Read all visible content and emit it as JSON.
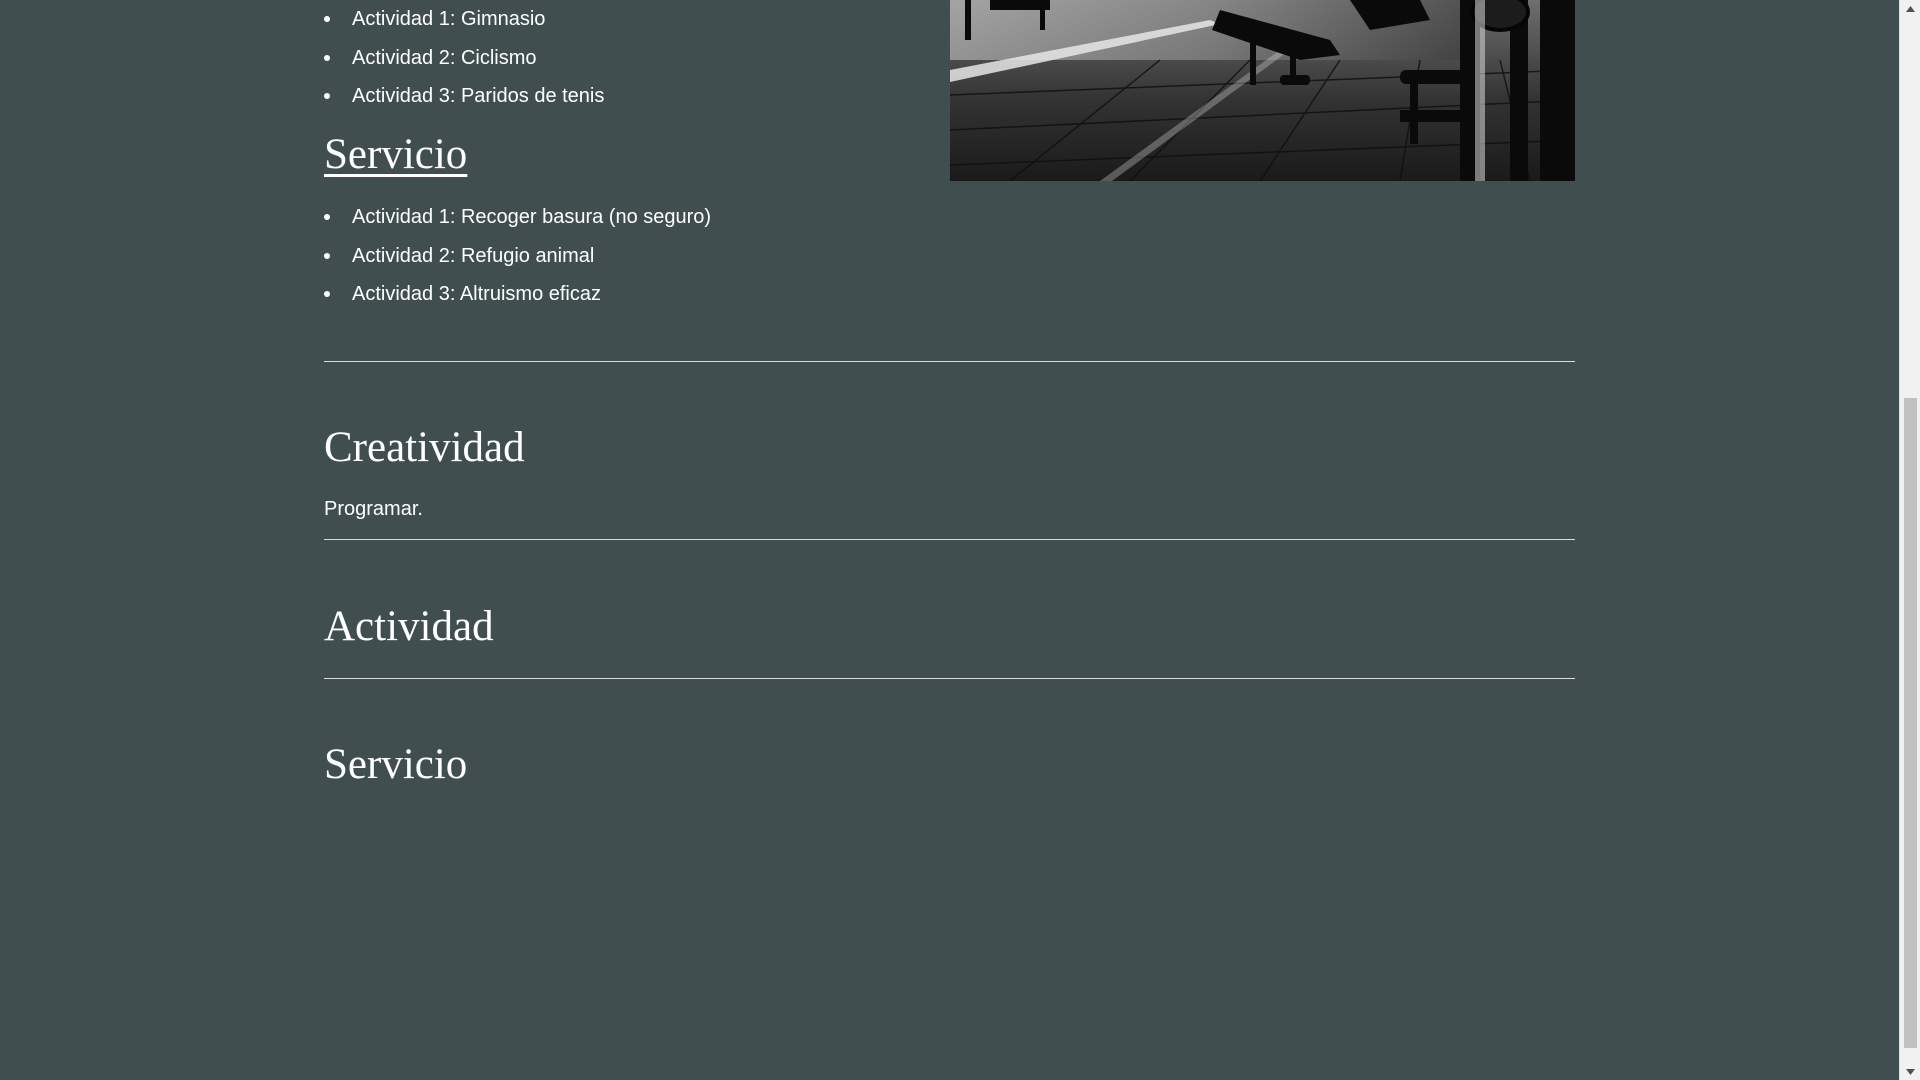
{
  "sections": {
    "top_list": [
      "Actividad 1: Gimnasio",
      "Actividad 2: Ciclismo",
      "Actividad 3: Paridos de tenis"
    ],
    "servicio_link": "Servicio",
    "servicio_list": [
      "Actividad 1: Recoger basura (no seguro)",
      "Actividad 2: Refugio animal",
      "Actividad 3: Altruismo eficaz"
    ],
    "creatividad_heading": "Creatividad",
    "creatividad_text": "Programar.",
    "actividad_heading": "Actividad",
    "servicio_heading": "Servicio"
  },
  "colors": {
    "background": "#404e4f",
    "text": "#ffffff",
    "rule": "#d8dcdc"
  },
  "icons": {
    "scroll_up": "triangle-up-icon",
    "scroll_down": "triangle-down-icon"
  }
}
